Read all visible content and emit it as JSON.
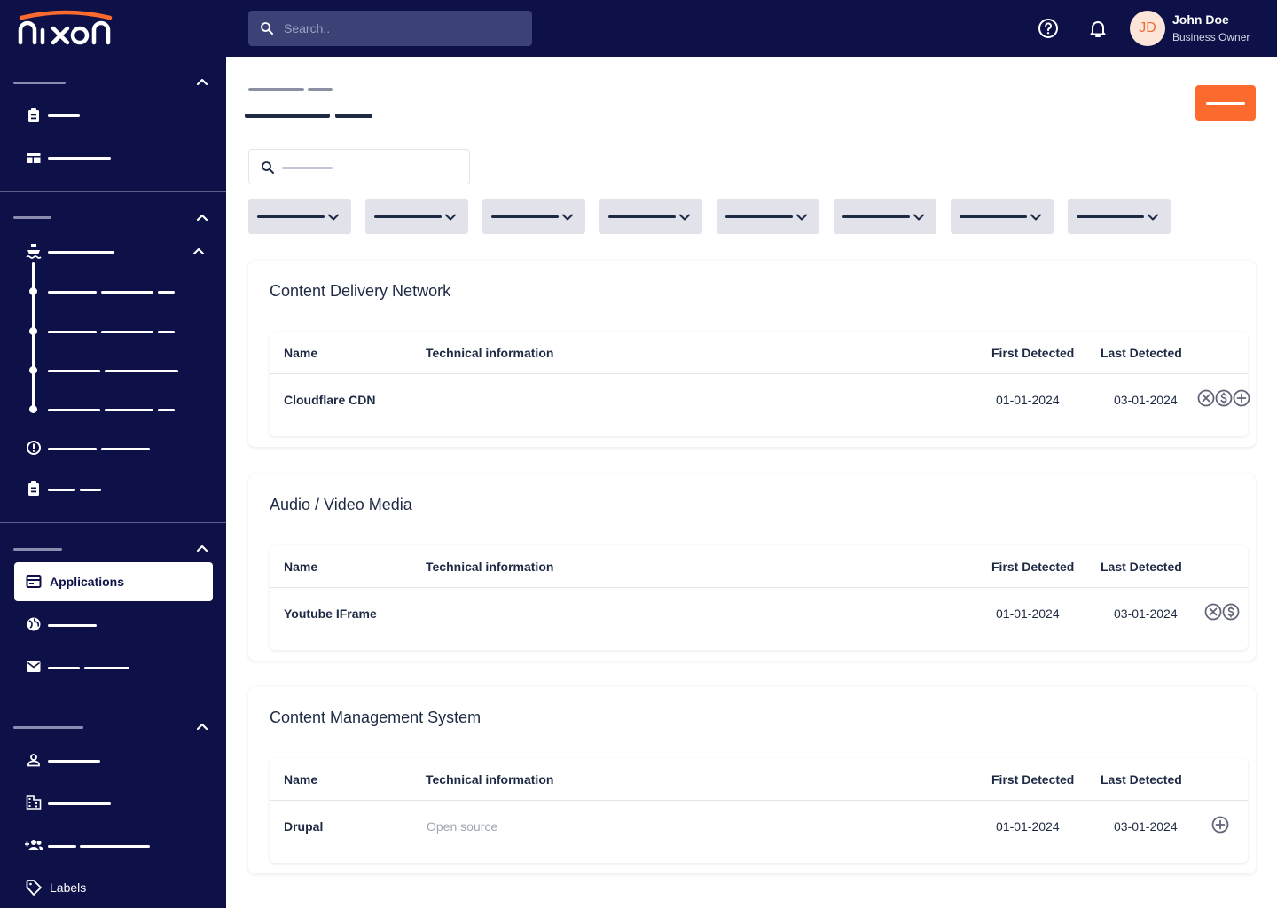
{
  "brand": {
    "accent": "#fc6b2d",
    "navy": "#0d1147"
  },
  "search": {
    "placeholder": "Search.."
  },
  "user": {
    "initials": "JD",
    "name": "John Doe",
    "role": "Business Owner"
  },
  "sidebar": {
    "active_item": "Applications",
    "labels_item": "Labels"
  },
  "sections": [
    {
      "title": "Content Delivery Network",
      "columns": [
        "Name",
        "Technical information",
        "First Detected",
        "Last Detected"
      ],
      "row": {
        "name": "Cloudflare CDN",
        "tech": "",
        "first": "01-01-2024",
        "last": "03-01-2024",
        "actions": [
          "close-circle-icon",
          "dollar-circle-icon",
          "plus-circle-icon"
        ]
      }
    },
    {
      "title": "Audio / Video Media",
      "columns": [
        "Name",
        "Technical information",
        "First Detected",
        "Last Detected"
      ],
      "row": {
        "name": "Youtube IFrame",
        "tech": "",
        "first": "01-01-2024",
        "last": "03-01-2024",
        "actions": [
          "close-circle-icon",
          "dollar-circle-icon"
        ]
      }
    },
    {
      "title": "Content Management System",
      "columns": [
        "Name",
        "Technical information",
        "First Detected",
        "Last Detected"
      ],
      "row": {
        "name": "Drupal",
        "tech": "Open source",
        "first": "01-01-2024",
        "last": "03-01-2024",
        "actions": [
          "plus-circle-icon"
        ]
      }
    }
  ]
}
